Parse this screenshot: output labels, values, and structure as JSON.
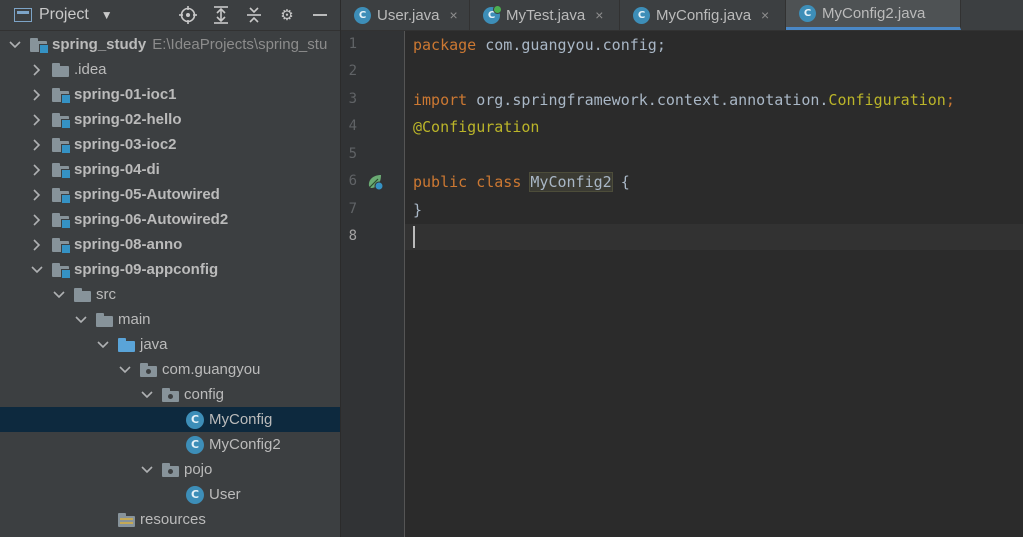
{
  "project_panel": {
    "title": "Project",
    "tools": [
      "locate-icon",
      "expand-all-icon",
      "collapse-all-icon",
      "gear-icon",
      "minimize-icon"
    ],
    "tree": [
      {
        "label": "spring_study",
        "path": "E:\\IdeaProjects\\spring_stu",
        "icon": "module-folder",
        "expanded": true
      },
      {
        "label": ".idea",
        "icon": "folder",
        "expanded": false
      },
      {
        "label": "spring-01-ioc1",
        "icon": "module-folder",
        "expanded": false
      },
      {
        "label": "spring-02-hello",
        "icon": "module-folder",
        "expanded": false
      },
      {
        "label": "spring-03-ioc2",
        "icon": "module-folder",
        "expanded": false
      },
      {
        "label": "spring-04-di",
        "icon": "module-folder",
        "expanded": false
      },
      {
        "label": "spring-05-Autowired",
        "icon": "module-folder",
        "expanded": false
      },
      {
        "label": "spring-06-Autowired2",
        "icon": "module-folder",
        "expanded": false
      },
      {
        "label": "spring-08-anno",
        "icon": "module-folder",
        "expanded": false
      },
      {
        "label": "spring-09-appconfig",
        "icon": "module-folder",
        "expanded": true
      },
      {
        "label": "src",
        "icon": "folder",
        "expanded": true
      },
      {
        "label": "main",
        "icon": "folder",
        "expanded": true
      },
      {
        "label": "java",
        "icon": "source-folder",
        "expanded": true
      },
      {
        "label": "com.guangyou",
        "icon": "package",
        "expanded": true
      },
      {
        "label": "config",
        "icon": "package",
        "expanded": true
      },
      {
        "label": "MyConfig",
        "icon": "class",
        "selected": true
      },
      {
        "label": "MyConfig2",
        "icon": "class"
      },
      {
        "label": "pojo",
        "icon": "package",
        "expanded": true
      },
      {
        "label": "User",
        "icon": "class"
      },
      {
        "label": "resources",
        "icon": "resources-folder"
      }
    ]
  },
  "editor": {
    "tabs": [
      {
        "label": "User.java",
        "icon": "class-icon",
        "active": false
      },
      {
        "label": "MyTest.java",
        "icon": "test-class-icon",
        "active": false
      },
      {
        "label": "MyConfig.java",
        "icon": "class-icon",
        "active": false
      },
      {
        "label": "MyConfig2.java",
        "icon": "class-icon",
        "active": true
      }
    ],
    "close_glyph": "×",
    "line_numbers": [
      "1",
      "2",
      "3",
      "4",
      "5",
      "6",
      "7",
      "8"
    ],
    "current_line": "8",
    "code": {
      "l1_kw": "package",
      "l1_rest": " com.guangyou.config;",
      "l3_kw": "import",
      "l3_pkg": " org.springframework.context.annotation.",
      "l3_cls": "Configuration",
      "l3_end": ";",
      "l4_ann": "@Configuration",
      "l6_kw": "public class",
      "l6_name": "MyConfig2",
      "l6_end": " {",
      "l7": "}"
    },
    "gutter_icon": "spring-bean-icon"
  },
  "colors": {
    "keyword": "#cc7832",
    "annotation": "#bbb529",
    "text": "#a9b7c6",
    "selection": "#0d293e",
    "class_icon": "#3d8eb8"
  }
}
